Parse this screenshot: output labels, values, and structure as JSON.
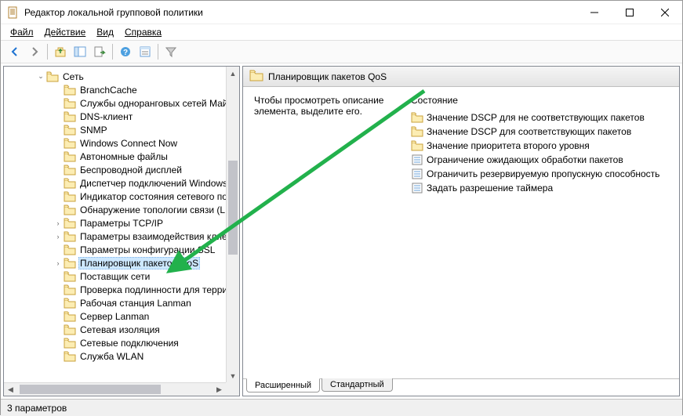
{
  "window": {
    "title": "Редактор локальной групповой политики"
  },
  "menu": {
    "file": "Файл",
    "action": "Действие",
    "view": "Вид",
    "help": "Справка"
  },
  "tree": {
    "root": "Сеть",
    "items": [
      "BranchCache",
      "Службы одноранговых сетей Май",
      "DNS-клиент",
      "SNMP",
      "Windows Connect Now",
      "Автономные файлы",
      "Беспроводной дисплей",
      "Диспетчер подключений Windows",
      "Индикатор состояния сетевого по",
      "Обнаружение топологии связи (L",
      "Параметры TCP/IP",
      "Параметры взаимодействия клиен",
      "Параметры конфигурации SSL",
      "Планировщик пакетов QoS",
      "Поставщик сети",
      "Проверка подлинности для терри",
      "Рабочая станция Lanman",
      "Сервер Lanman",
      "Сетевая изоляция",
      "Сетевые подключения",
      "Служба WLAN"
    ],
    "selected_index": 13
  },
  "right": {
    "header": "Планировщик пакетов QoS",
    "description": "Чтобы просмотреть описание элемента, выделите его.",
    "state_header": "Состояние",
    "items": [
      {
        "type": "folder",
        "label": "Значение DSCP для не соответствующих пакетов"
      },
      {
        "type": "folder",
        "label": "Значение DSCP для соответствующих пакетов"
      },
      {
        "type": "folder",
        "label": "Значение приоритета второго уровня"
      },
      {
        "type": "setting",
        "label": "Ограничение ожидающих обработки пакетов"
      },
      {
        "type": "setting",
        "label": "Ограничить резервируемую пропускную способность"
      },
      {
        "type": "setting",
        "label": "Задать разрешение таймера"
      }
    ]
  },
  "tabs": {
    "extended": "Расширенный",
    "standard": "Стандартный"
  },
  "status": "3 параметров"
}
